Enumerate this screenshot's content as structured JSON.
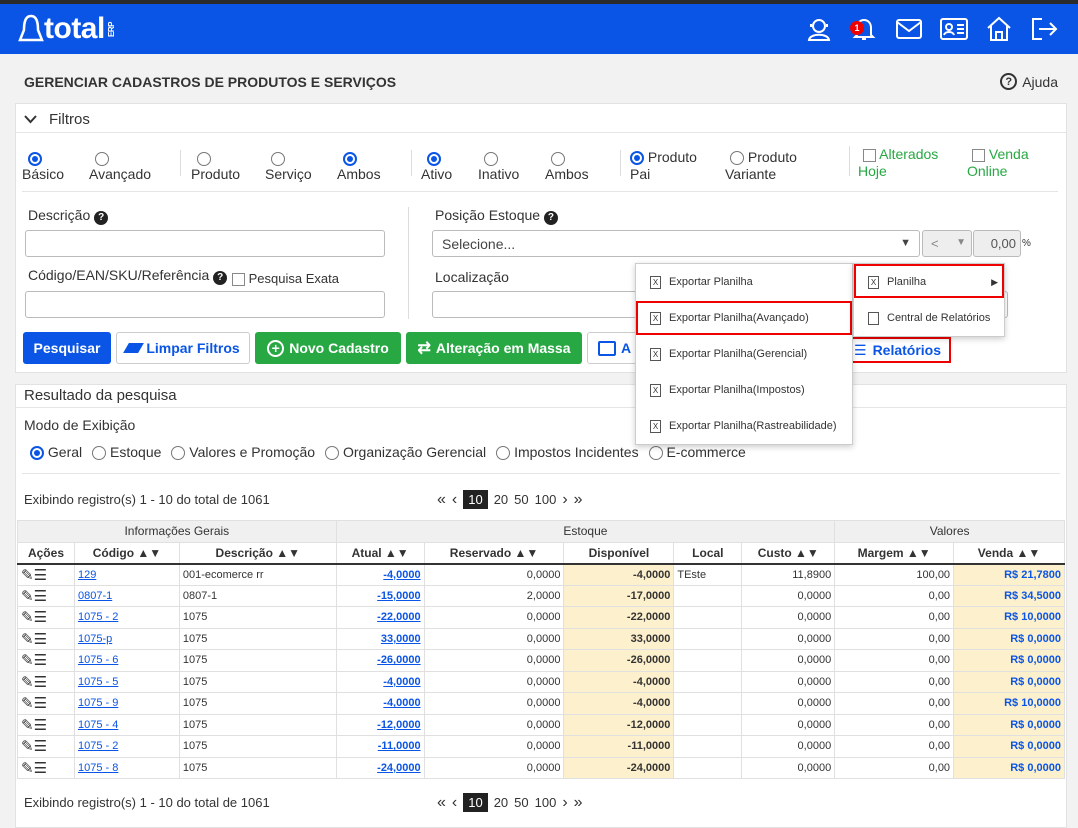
{
  "brand": {
    "logo": "total",
    "erp": "ERP",
    "notif_count": "1"
  },
  "page": {
    "title": "GERENCIAR CADASTROS DE PRODUTOS E SERVIÇOS",
    "help": "Ajuda"
  },
  "filters": {
    "title": "Filtros",
    "radios1": [
      "Básico",
      "Avançado"
    ],
    "radios2": [
      "Produto",
      "Serviço",
      "Ambos"
    ],
    "radios3": [
      "Ativo",
      "Inativo",
      "Ambos"
    ],
    "radios4": [
      [
        "Produto",
        "Pai"
      ],
      [
        "Produto",
        "Variante"
      ]
    ],
    "checks": [
      [
        "Alterados",
        "Hoje"
      ],
      [
        "Venda",
        "Online"
      ]
    ],
    "descricao": "Descrição",
    "codigo": "Código/EAN/SKU/Referência",
    "pesquisa_exata": "Pesquisa Exata",
    "posicao": "Posição Estoque",
    "posicao_value": "Selecione...",
    "cmp": "<",
    "qty": "0,00",
    "pct": "%",
    "localizacao": "Localização"
  },
  "buttons": {
    "pesquisar": "Pesquisar",
    "limpar": "Limpar Filtros",
    "novo": "Novo Cadastro",
    "massa": "Alteração em Massa",
    "a": "A",
    "relatorios": "Relatórios"
  },
  "menu": {
    "items": [
      "Exportar Planilha",
      "Exportar Planilha(Avançado)",
      "Exportar Planilha(Gerencial)",
      "Exportar Planilha(Impostos)",
      "Exportar Planilha(Rastreabilidade)"
    ],
    "sub": [
      "Planilha",
      "Central de Relatórios"
    ]
  },
  "results": {
    "title": "Resultado da pesquisa",
    "modo": "Modo de Exibição",
    "modes": [
      "Geral",
      "Estoque",
      "Valores e Promoção",
      "Organização Gerencial",
      "Impostos Incidentes",
      "E-commerce"
    ],
    "showing": "Exibindo registro(s) 1 - 10 do total de 1061",
    "pages": [
      "10",
      "20",
      "50",
      "100"
    ]
  },
  "table": {
    "groups": [
      "Informações Gerais",
      "Estoque",
      "Valores"
    ],
    "headers": [
      "Ações",
      "Código",
      "Descrição",
      "Atual",
      "Reservado",
      "Disponível",
      "Local",
      "Custo",
      "Margem",
      "Venda"
    ],
    "rows": [
      [
        "129",
        "001-ecomerce rr",
        "-4,0000",
        "0,0000",
        "-4,0000",
        "TEste",
        "11,8900",
        "100,00",
        "R$ 21,7800"
      ],
      [
        "0807-1",
        "0807-1",
        "-15,0000",
        "2,0000",
        "-17,0000",
        "",
        "0,0000",
        "0,00",
        "R$ 34,5000"
      ],
      [
        "1075 - 2",
        "1075",
        "-22,0000",
        "0,0000",
        "-22,0000",
        "",
        "0,0000",
        "0,00",
        "R$ 10,0000"
      ],
      [
        "1075-p",
        "1075",
        "33,0000",
        "0,0000",
        "33,0000",
        "",
        "0,0000",
        "0,00",
        "R$ 0,0000"
      ],
      [
        "1075 - 6",
        "1075",
        "-26,0000",
        "0,0000",
        "-26,0000",
        "",
        "0,0000",
        "0,00",
        "R$ 0,0000"
      ],
      [
        "1075 - 5",
        "1075",
        "-4,0000",
        "0,0000",
        "-4,0000",
        "",
        "0,0000",
        "0,00",
        "R$ 0,0000"
      ],
      [
        "1075 - 9",
        "1075",
        "-4,0000",
        "0,0000",
        "-4,0000",
        "",
        "0,0000",
        "0,00",
        "R$ 10,0000"
      ],
      [
        "1075 - 4",
        "1075",
        "-12,0000",
        "0,0000",
        "-12,0000",
        "",
        "0,0000",
        "0,00",
        "R$ 0,0000"
      ],
      [
        "1075 - 2",
        "1075",
        "-11,0000",
        "0,0000",
        "-11,0000",
        "",
        "0,0000",
        "0,00",
        "R$ 0,0000"
      ],
      [
        "1075 - 8",
        "1075",
        "-24,0000",
        "0,0000",
        "-24,0000",
        "",
        "0,0000",
        "0,00",
        "R$ 0,0000"
      ]
    ]
  }
}
